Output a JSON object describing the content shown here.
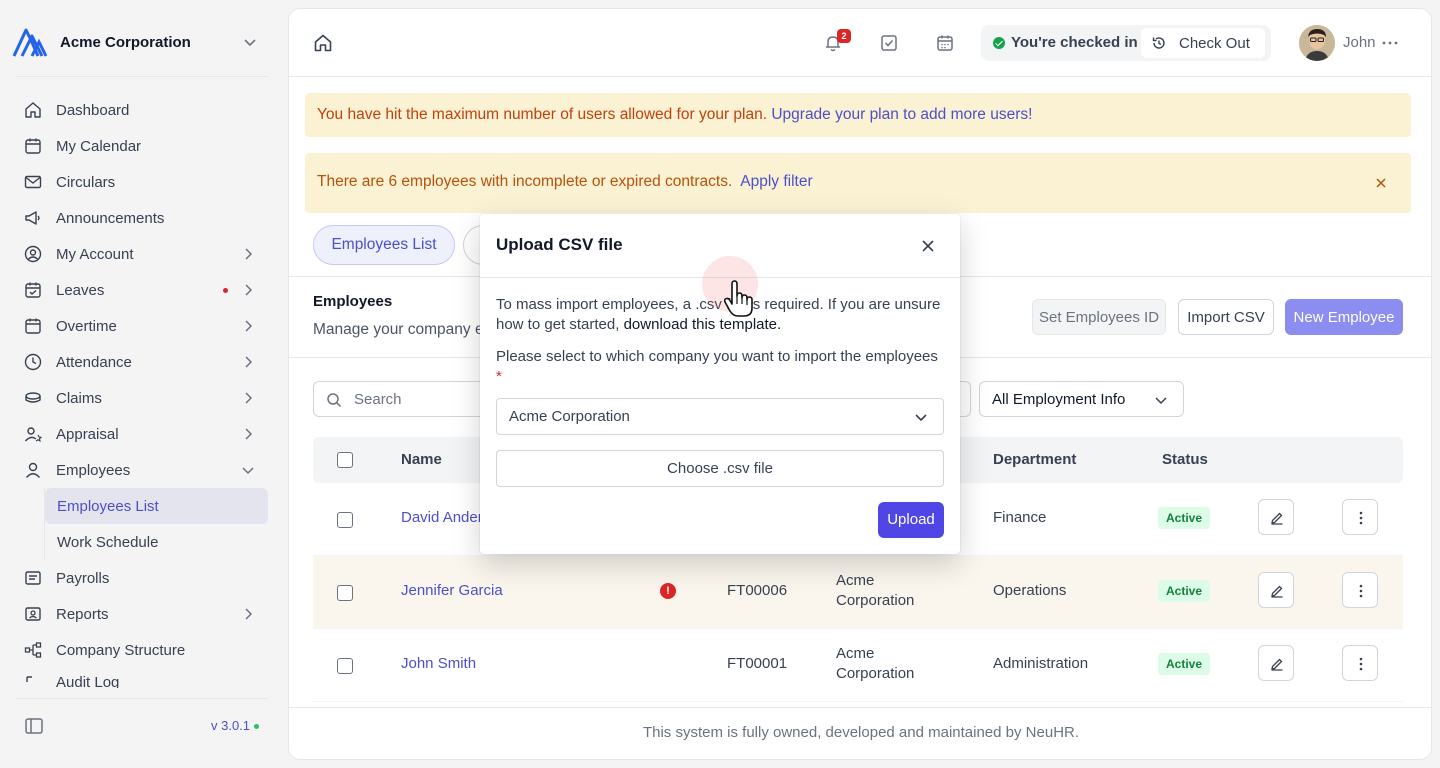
{
  "sidebar": {
    "company": "Acme Corporation",
    "items": [
      {
        "label": "Dashboard"
      },
      {
        "label": "My Calendar"
      },
      {
        "label": "Circulars"
      },
      {
        "label": "Announcements"
      },
      {
        "label": "My Account"
      },
      {
        "label": "Leaves"
      },
      {
        "label": "Overtime"
      },
      {
        "label": "Attendance"
      },
      {
        "label": "Claims"
      },
      {
        "label": "Appraisal"
      },
      {
        "label": "Employees"
      },
      {
        "label": "Payrolls"
      },
      {
        "label": "Reports"
      },
      {
        "label": "Company Structure"
      },
      {
        "label": "Audit Log"
      }
    ],
    "employees_sub": [
      {
        "label": "Employees List"
      },
      {
        "label": "Work Schedule"
      }
    ],
    "version": "v 3.0.1"
  },
  "topbar": {
    "notification_count": "2",
    "checkin_status": "You're checked in",
    "checkout_label": "Check Out",
    "user_name": "John"
  },
  "alerts": {
    "plan_limit_text": "You have hit the maximum number of users allowed for your plan.",
    "plan_limit_link": "Upgrade your plan to add more users!",
    "contracts_text": "There are 6 employees with incomplete or expired contracts.",
    "contracts_link": "Apply filter"
  },
  "tabs": [
    {
      "label": "Employees List"
    }
  ],
  "section": {
    "title": "Employees",
    "subtitle": "Manage your company employees",
    "buttons": {
      "set_id": "Set Employees ID",
      "import_csv": "Import CSV",
      "new_employee": "New Employee"
    }
  },
  "filters": {
    "search_placeholder": "Search",
    "employment_info": "All Employment Info"
  },
  "table": {
    "headers": {
      "name": "Name",
      "department": "Department",
      "status": "Status"
    },
    "rows": [
      {
        "name": "David Anderson",
        "id": "",
        "company_line1": "",
        "company_line2": "",
        "department": "Finance",
        "status": "Active"
      },
      {
        "name": "Jennifer Garcia",
        "id": "FT00006",
        "company_line1": "Acme",
        "company_line2": "Corporation",
        "department": "Operations",
        "status": "Active",
        "warning": "!"
      },
      {
        "name": "John Smith",
        "id": "FT00001",
        "company_line1": "Acme",
        "company_line2": "Corporation",
        "department": "Administration",
        "status": "Active"
      }
    ]
  },
  "footer": {
    "text": "This system is fully owned, developed and maintained by NeuHR."
  },
  "modal": {
    "title": "Upload CSV file",
    "description": "To mass import employees, a .csv file is required. If you are unsure how to get started,",
    "template_link": "download this template.",
    "question": "Please select to which company you want to import the employees",
    "required_mark": "*",
    "company_selected": "Acme Corporation",
    "choose_file_label": "Choose .csv file",
    "upload_label": "Upload"
  },
  "colors": {
    "accent": "#4f46e5",
    "alert_bg": "#fbf1d3",
    "active_badge": "#dcfce7"
  }
}
